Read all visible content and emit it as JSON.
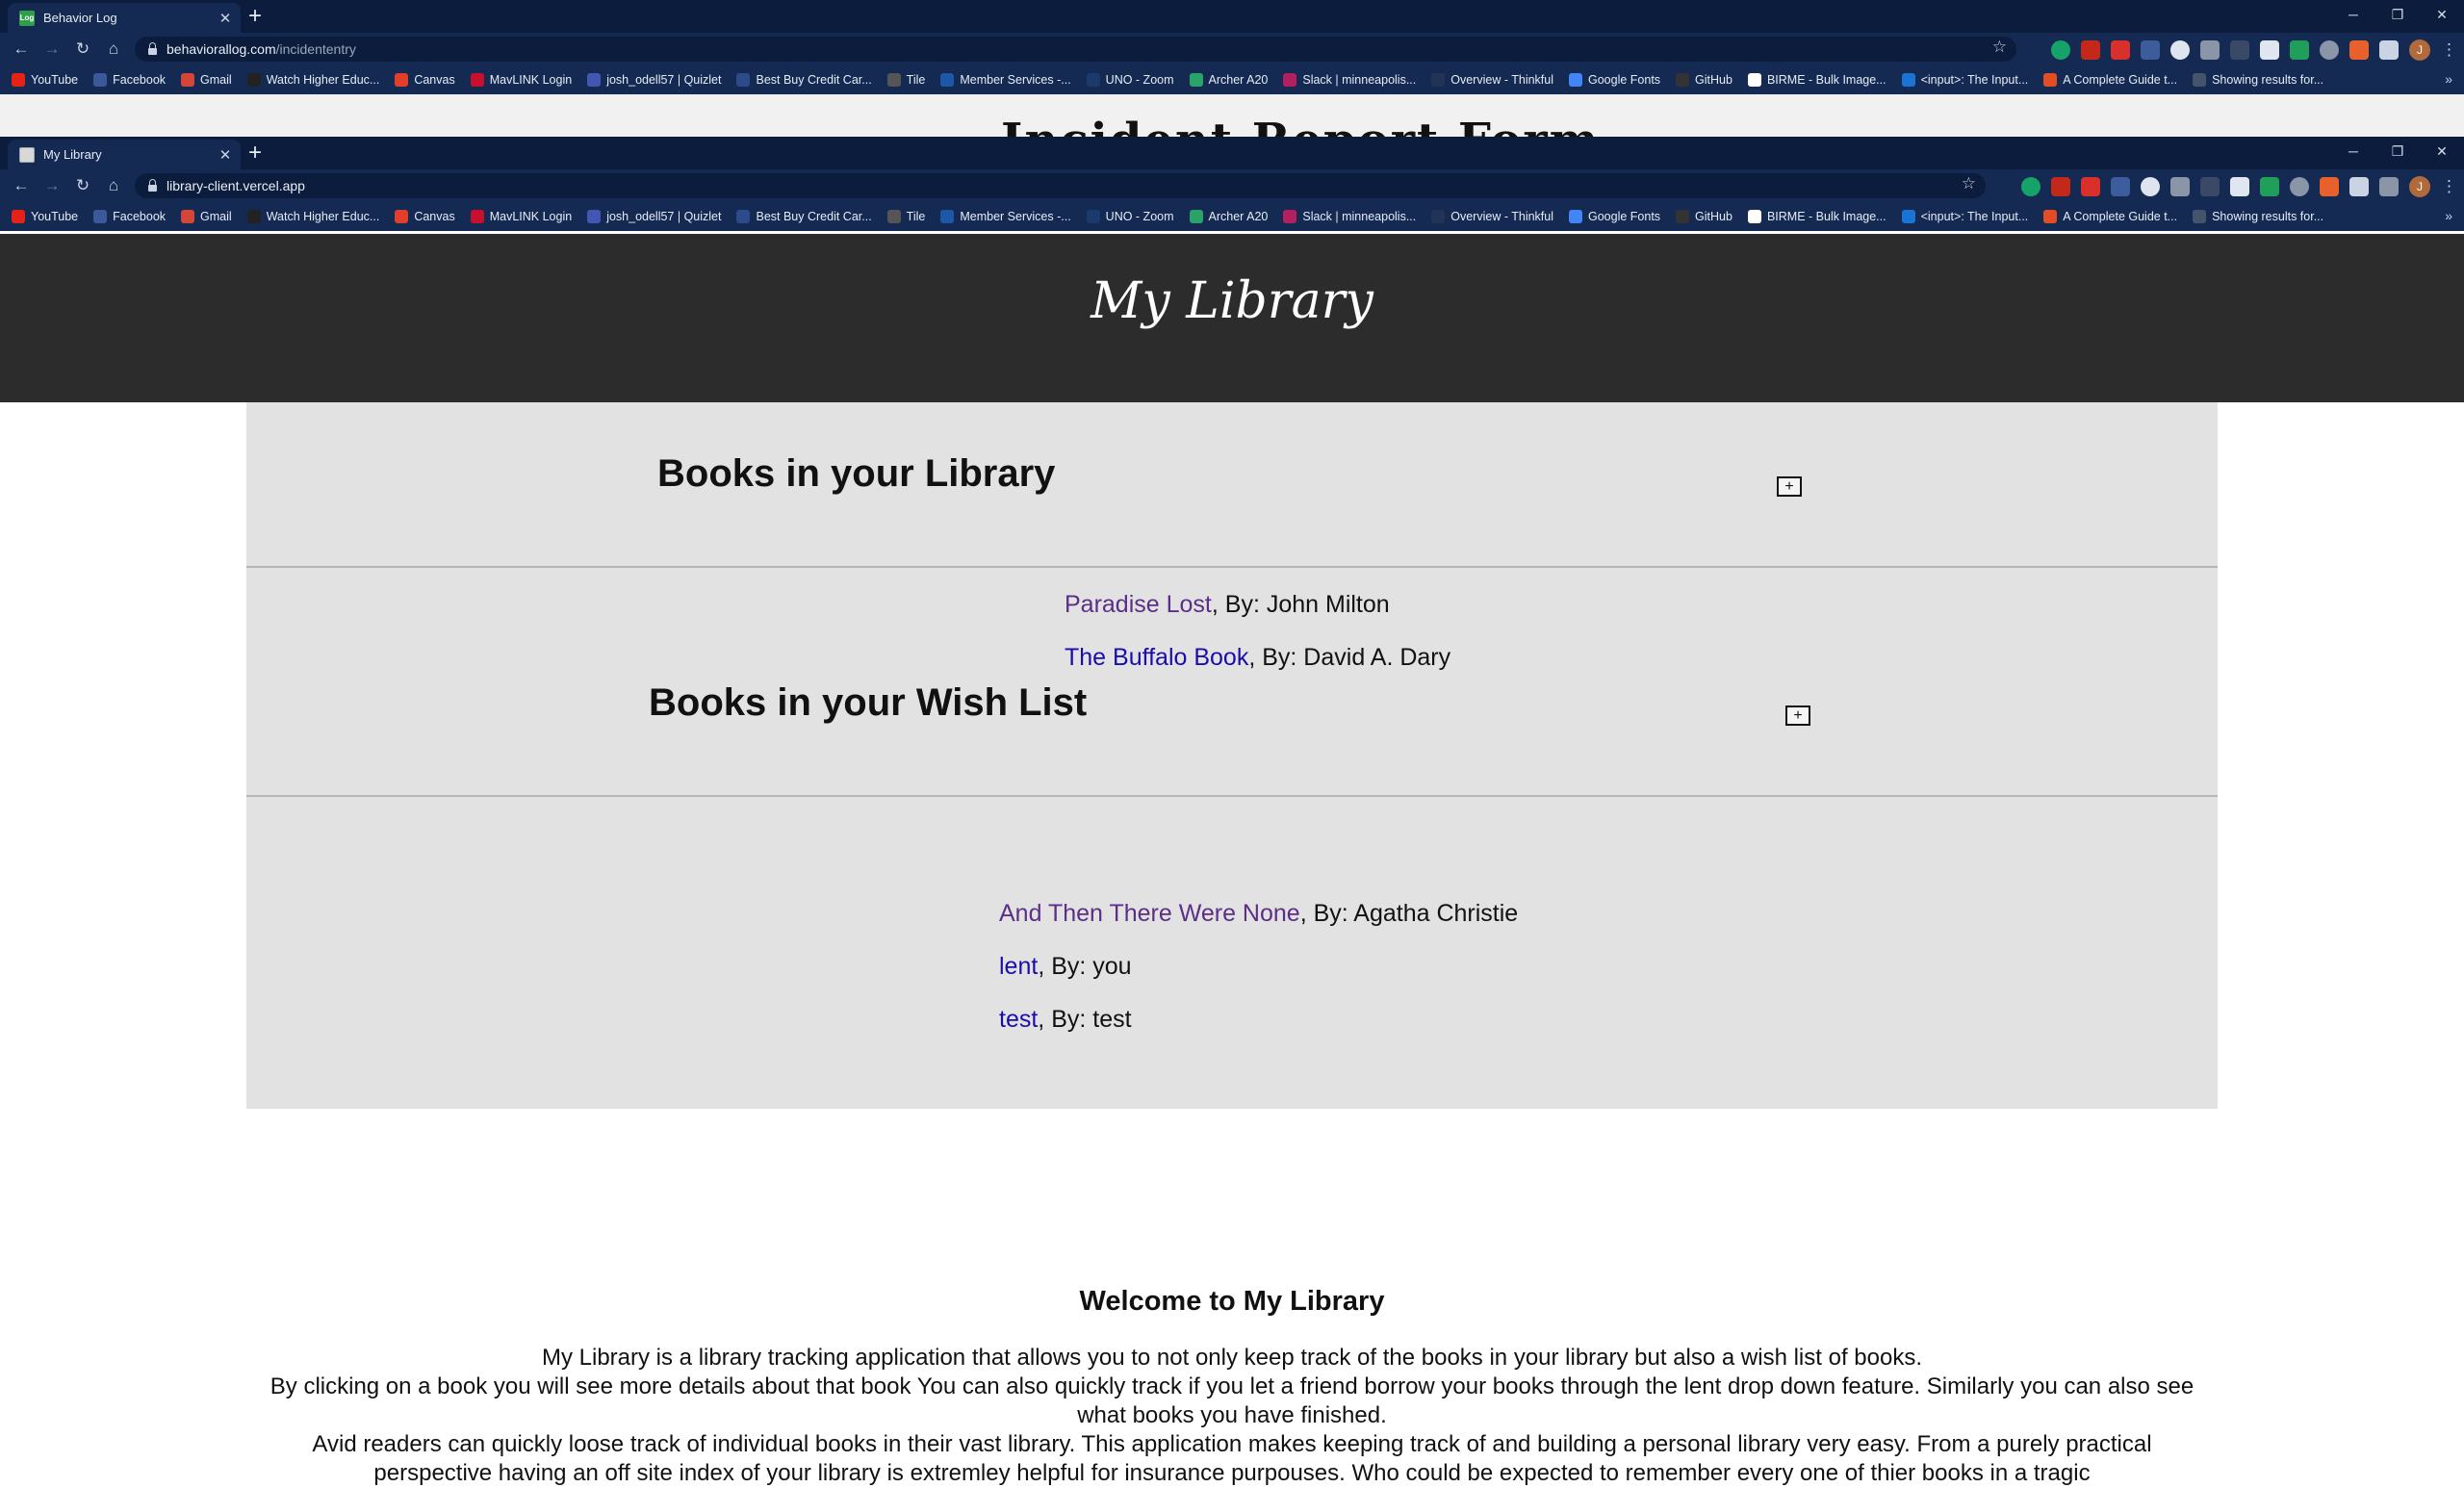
{
  "browser_back": {
    "tab_title": "Behavior Log",
    "tab_favicon_text": "Log",
    "url_host": "behaviorallog.com",
    "url_path": "/incidententry",
    "page_peek_title": "Incident Report Form"
  },
  "browser_front": {
    "tab_title": "My Library",
    "url_host": "library-client.vercel.app",
    "url_path": ""
  },
  "bookmarks": [
    {
      "label": "YouTube",
      "color": "#e62117"
    },
    {
      "label": "Facebook",
      "color": "#3b5998"
    },
    {
      "label": "Gmail",
      "color": "#d44638"
    },
    {
      "label": "Watch Higher Educ...",
      "color": "#222222"
    },
    {
      "label": "Canvas",
      "color": "#e13f2b"
    },
    {
      "label": "MavLINK Login",
      "color": "#c8102e"
    },
    {
      "label": "josh_odell57 | Quizlet",
      "color": "#4257b2"
    },
    {
      "label": "Best Buy Credit Car...",
      "color": "#2d4a8a"
    },
    {
      "label": "Tile",
      "color": "#555555"
    },
    {
      "label": "Member Services -...",
      "color": "#1d57a8"
    },
    {
      "label": "UNO - Zoom",
      "color": "#1b3a6b"
    },
    {
      "label": "Archer A20",
      "color": "#2aa36a"
    },
    {
      "label": "Slack | minneapolis...",
      "color": "#b3205f"
    },
    {
      "label": "Overview - Thinkful",
      "color": "#223355"
    },
    {
      "label": "Google Fonts",
      "color": "#4285f4"
    },
    {
      "label": "GitHub",
      "color": "#333333"
    },
    {
      "label": "BIRME - Bulk Image...",
      "color": "#ffffff"
    },
    {
      "label": "<input>: The Input...",
      "color": "#1b73d3"
    },
    {
      "label": "A Complete Guide t...",
      "color": "#e34d26"
    },
    {
      "label": "Showing results for...",
      "color": "#44556b"
    }
  ],
  "header": {
    "title": "My Library"
  },
  "library": {
    "title": "Books in your Library",
    "toggle": "+",
    "books": [
      {
        "title": "Paradise Lost",
        "author": ", By: John Milton"
      },
      {
        "title": "The Buffalo Book",
        "author": ", By: David A. Dary"
      }
    ]
  },
  "wishlist": {
    "title": "Books in your Wish List",
    "toggle": "+",
    "books": [
      {
        "title": "And Then There Were None",
        "author": ", By: Agatha Christie"
      },
      {
        "title": "lent",
        "author": ", By: you"
      },
      {
        "title": "test",
        "author": ", By: test"
      }
    ]
  },
  "welcome": {
    "title": "Welcome to My Library",
    "lines": [
      "My Library is a library tracking application that allows you to not only keep track of the books in your library but also a wish list of books.",
      "By clicking on a book you will see more details about that book You can also quickly track if you let a friend borrow your books through the lent drop down feature. Similarly you can also see what books you have finished.",
      "Avid readers can quickly loose track of individual books in their vast library. This application makes keeping track of and building a personal library very easy. From a purely practical perspective having an off site index of your library is extremley helpful for insurance purpouses. Who could be expected to remember every one of thier books in a tragic"
    ]
  },
  "colors": {
    "chrome_dark": "#0b1c3d",
    "chrome": "#142a52",
    "header_bg": "#2c2c2c",
    "panel_bg": "#e2e2e2",
    "link_visited": "#5b2f86",
    "link": "#1a0dab"
  },
  "icons": {
    "nav": [
      "back-arrow-icon",
      "forward-arrow-icon",
      "reload-icon",
      "home-icon"
    ],
    "window": [
      "minimize-icon",
      "restore-icon",
      "close-icon"
    ]
  }
}
